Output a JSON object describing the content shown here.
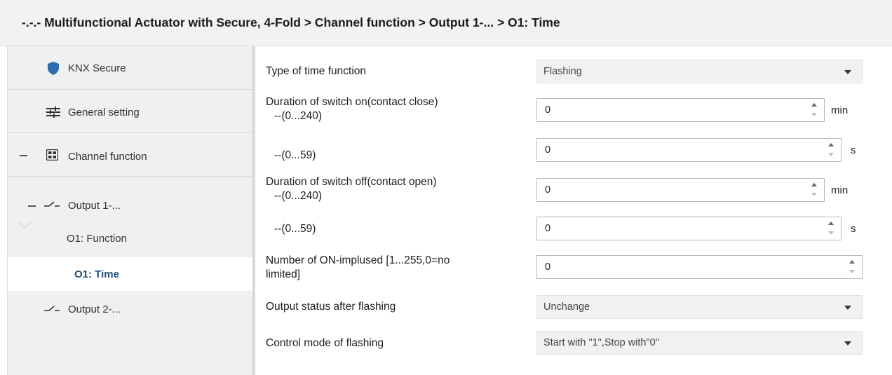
{
  "breadcrumb": "-.-.- Multifunctional Actuator with Secure, 4-Fold > Channel function > Output 1-... > O1: Time",
  "colors": {
    "accent": "#1f4e79",
    "shield": "#2b6cb0",
    "sidebar_bg": "#f0f0f0"
  },
  "sidebar": {
    "items": [
      {
        "label": "KNX Secure",
        "icon": "shield-icon"
      },
      {
        "label": "General setting",
        "icon": "sliders-icon"
      },
      {
        "label": "Channel function",
        "icon": "grid-icon",
        "expand": "−"
      },
      {
        "label": "Output 1-...",
        "icon": "switch-contact-icon",
        "expand": "−"
      },
      {
        "label": "O1: Function"
      },
      {
        "label": "O1: Time",
        "selected": true
      },
      {
        "label": "Output 2-...",
        "icon": "switch-contact-icon"
      }
    ]
  },
  "params": {
    "type_of_time_function": {
      "label": "Type of time function",
      "value": "Flashing"
    },
    "duration_on_min": {
      "label": "Duration of switch on(contact close)",
      "range": "--(0...240)",
      "value": "0",
      "unit": "min"
    },
    "duration_on_s": {
      "range": "--(0...59)",
      "value": "0",
      "unit": "s"
    },
    "duration_off_min": {
      "label": "Duration of switch off(contact open)",
      "range": "--(0...240)",
      "value": "0",
      "unit": "min"
    },
    "duration_off_s": {
      "range": "--(0...59)",
      "value": "0",
      "unit": "s"
    },
    "on_impulses": {
      "label_line1": "Number of ON-implused [1...255,0=no",
      "label_line2": "limited]",
      "value": "0"
    },
    "output_status": {
      "label": "Output status after flashing",
      "value": "Unchange"
    },
    "control_mode": {
      "label": "Control mode of flashing",
      "value": "Start with \"1\",Stop with\"0\""
    }
  }
}
